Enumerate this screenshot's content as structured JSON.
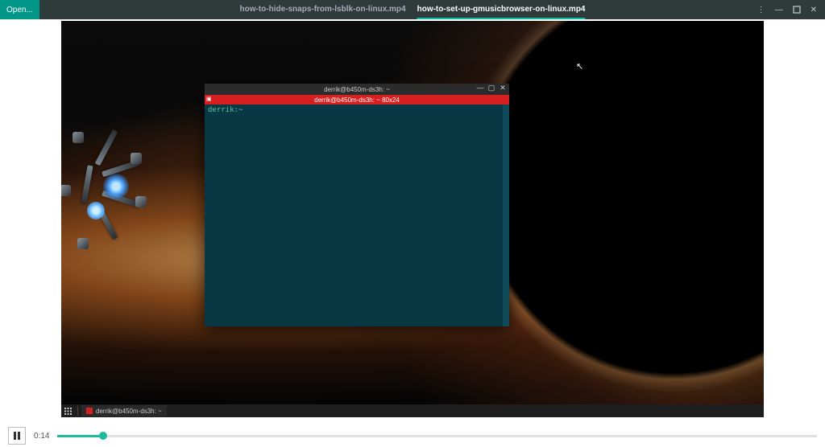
{
  "header": {
    "open_label": "Open...",
    "tabs": [
      {
        "label": "how-to-hide-snaps-from-lsblk-on-linux.mp4",
        "active": false
      },
      {
        "label": "how-to-set-up-gmusicbrowser-on-linux.mp4",
        "active": true
      }
    ]
  },
  "video": {
    "terminal": {
      "title": "derrik@b450m-ds3h: ~",
      "tab_label": "derrik@b450m-ds3h: ~ 80x24",
      "prompt_user": "derrik:",
      "prompt_path": "~"
    },
    "taskbar": {
      "task_label": "derrik@b450m-ds3h: ~"
    }
  },
  "player": {
    "time": "0:14",
    "progress_percent": 6
  }
}
